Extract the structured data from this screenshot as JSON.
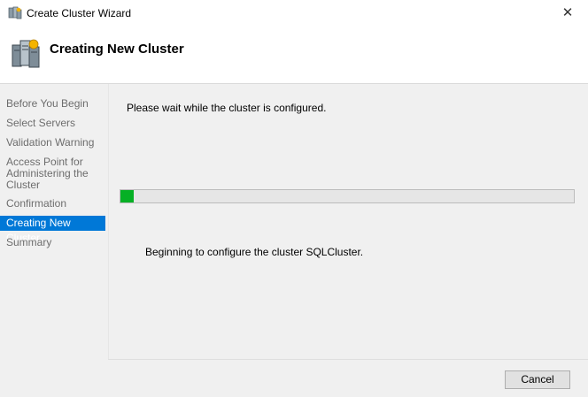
{
  "window": {
    "title": "Create Cluster Wizard",
    "close_glyph": "✕"
  },
  "header": {
    "title": "Creating New Cluster",
    "icon": "cluster-servers-icon"
  },
  "sidebar": {
    "items": [
      {
        "label": "Before You Begin"
      },
      {
        "label": "Select Servers"
      },
      {
        "label": "Validation Warning"
      },
      {
        "label": "Access Point for Administering the Cluster"
      },
      {
        "label": "Confirmation"
      },
      {
        "label": "Creating New Cluster",
        "active": true
      },
      {
        "label": "Summary"
      }
    ]
  },
  "main": {
    "message": "Please wait while the cluster is configured.",
    "progress": {
      "value_percent": 3,
      "color": "#06b025"
    },
    "status": "Beginning to configure the cluster SQLCluster."
  },
  "footer": {
    "cancel_label": "Cancel"
  },
  "colors": {
    "accent": "#0078d7",
    "progress_green": "#06b025"
  }
}
